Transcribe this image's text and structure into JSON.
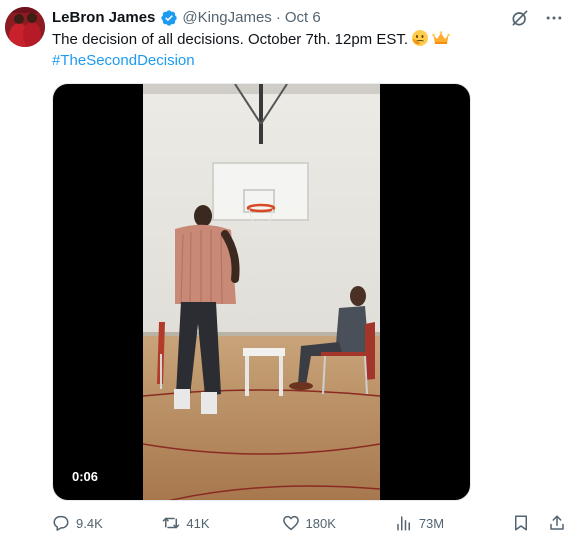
{
  "author": {
    "name": "LeBron James",
    "handle": "@KingJames",
    "separator": "·",
    "date": "Oct 6",
    "verified": true
  },
  "tweet": {
    "text": "The decision of all decisions. October 7th. 12pm EST.",
    "emojis": [
      "thinking-face",
      "crown"
    ],
    "hashtag": "#TheSecondDecision"
  },
  "media": {
    "type": "video",
    "timestamp": "0:06"
  },
  "actions": {
    "replies": "9.4K",
    "retweets": "41K",
    "likes": "180K",
    "views": "73M"
  },
  "colors": {
    "link": "#1d9bf0",
    "secondary_text": "#536471",
    "verified_badge": "#1d9bf0"
  },
  "icons": {
    "grok": "slash-circle-icon",
    "more": "ellipsis-icon",
    "reply": "speech-bubble-icon",
    "retweet": "retweet-arrows-icon",
    "like": "heart-icon",
    "views": "bar-chart-icon",
    "bookmark": "bookmark-icon",
    "share": "share-icon"
  }
}
